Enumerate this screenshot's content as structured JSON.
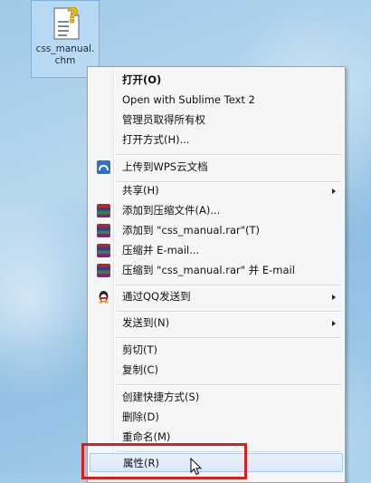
{
  "desktop": {
    "icon": {
      "name": "file-help-icon",
      "label_line1": "css_manual.",
      "label_line2": "chm"
    }
  },
  "context_menu": {
    "items": [
      {
        "id": "open",
        "label": "打开(O)",
        "bold": true
      },
      {
        "id": "open-sublime",
        "label": "Open with Sublime Text 2"
      },
      {
        "id": "take-ownership",
        "label": "管理员取得所有权"
      },
      {
        "id": "open-with",
        "label": "打开方式(H)..."
      },
      {
        "id": "upload-wps",
        "label": "上传到WPS云文档",
        "icon": "wps-cloud-icon"
      },
      {
        "id": "share",
        "label": "共享(H)",
        "submenu": true
      },
      {
        "id": "add-archive",
        "label": "添加到压缩文件(A)...",
        "icon": "winrar-icon"
      },
      {
        "id": "add-rar",
        "label": "添加到 \"css_manual.rar\"(T)",
        "icon": "winrar-icon"
      },
      {
        "id": "compress-email",
        "label": "压缩并 E-mail...",
        "icon": "winrar-icon"
      },
      {
        "id": "compress-rar-email",
        "label": "压缩到 \"css_manual.rar\" 并 E-mail",
        "icon": "winrar-icon"
      },
      {
        "id": "send-qq",
        "label": "通过QQ发送到",
        "icon": "qq-penguin-icon",
        "submenu": true
      },
      {
        "id": "send-to",
        "label": "发送到(N)",
        "submenu": true
      },
      {
        "id": "cut",
        "label": "剪切(T)"
      },
      {
        "id": "copy",
        "label": "复制(C)"
      },
      {
        "id": "create-shortcut",
        "label": "创建快捷方式(S)"
      },
      {
        "id": "delete",
        "label": "删除(D)"
      },
      {
        "id": "rename",
        "label": "重命名(M)"
      },
      {
        "id": "properties",
        "label": "属性(R)",
        "highlighted": true
      }
    ]
  },
  "colors": {
    "highlight_box": "#d81e1e",
    "menu_background": "#f5f6f7",
    "desktop_background": "#9ec9e8"
  }
}
